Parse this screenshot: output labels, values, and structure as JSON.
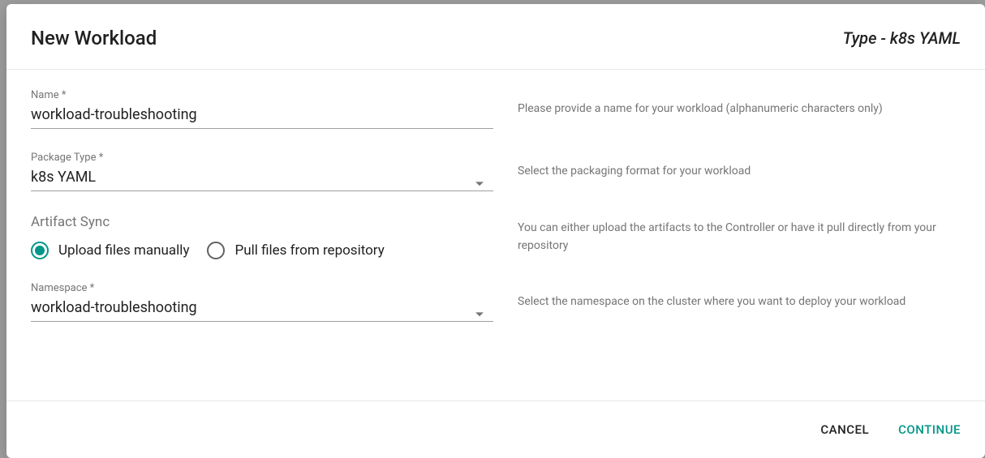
{
  "header": {
    "title": "New Workload",
    "type_label": "Type - k8s YAML"
  },
  "fields": {
    "name": {
      "label": "Name *",
      "value": "workload-troubleshooting",
      "help": "Please provide a name for your workload (alphanumeric characters only)"
    },
    "package_type": {
      "label": "Package Type *",
      "value": "k8s YAML",
      "help": "Select the packaging format for your workload"
    },
    "artifact_sync": {
      "heading": "Artifact Sync",
      "options": {
        "upload": "Upload files manually",
        "pull": "Pull files from repository"
      },
      "selected": "upload",
      "help": "You can either upload the artifacts to the Controller or have it pull directly from your repository"
    },
    "namespace": {
      "label": "Namespace *",
      "value": "workload-troubleshooting",
      "help": "Select the namespace on the cluster where you want to deploy your workload"
    }
  },
  "footer": {
    "cancel": "CANCEL",
    "continue": "CONTINUE"
  },
  "colors": {
    "accent": "#009688"
  }
}
